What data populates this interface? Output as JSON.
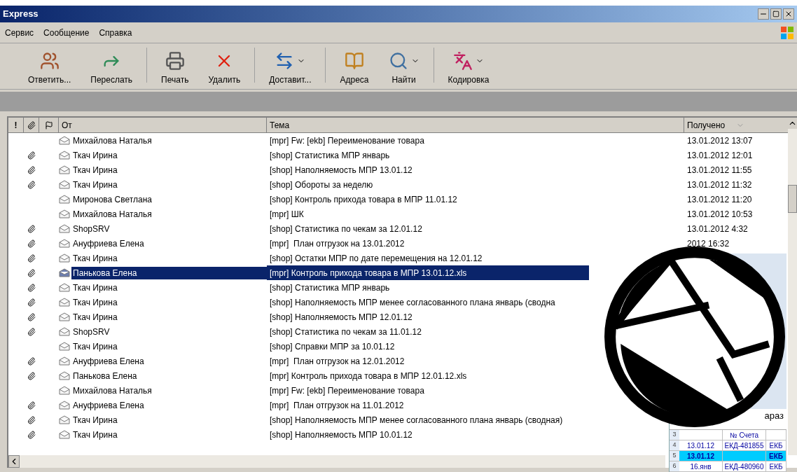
{
  "window": {
    "title": "Express"
  },
  "menu": [
    "Сервис",
    "Сообщение",
    "Справка"
  ],
  "toolbar": [
    {
      "label": "Ответить...",
      "kind": "reply",
      "dropdown": false
    },
    {
      "label": "Переслать",
      "kind": "forward",
      "dropdown": false
    },
    {
      "label": "Печать",
      "kind": "print",
      "dropdown": false
    },
    {
      "label": "Удалить",
      "kind": "delete",
      "dropdown": false
    },
    {
      "label": "Доставит...",
      "kind": "sync",
      "dropdown": true
    },
    {
      "label": "Адреса",
      "kind": "addresses",
      "dropdown": false
    },
    {
      "label": "Найти",
      "kind": "find",
      "dropdown": true
    },
    {
      "label": "Кодировка",
      "kind": "encoding",
      "dropdown": true
    }
  ],
  "table": {
    "columns": [
      "!",
      "От",
      "Тема",
      "Получено"
    ],
    "rows": [
      {
        "attachment": false,
        "selected": false,
        "from": "Михайлова Наталья",
        "subject": "[mpr] Fw: [ekb] Переименование товара",
        "received": "13.01.2012 13:07"
      },
      {
        "attachment": true,
        "selected": false,
        "from": "Ткач Ирина",
        "subject": "[shop] Статистика МПР январь",
        "received": "13.01.2012 12:01"
      },
      {
        "attachment": true,
        "selected": false,
        "from": "Ткач Ирина",
        "subject": "[shop] Наполняемость МПР 13.01.12",
        "received": "13.01.2012 11:55"
      },
      {
        "attachment": true,
        "selected": false,
        "from": "Ткач Ирина",
        "subject": "[shop] Обороты за неделю",
        "received": "13.01.2012 11:32"
      },
      {
        "attachment": false,
        "selected": false,
        "from": "Миронова Светлана",
        "subject": "[shop] Контроль прихода товара в МПР 11.01.12",
        "received": "13.01.2012 11:20"
      },
      {
        "attachment": false,
        "selected": false,
        "from": "Михайлова Наталья",
        "subject": "[mpr] ШК",
        "received": "13.01.2012 10:53"
      },
      {
        "attachment": true,
        "selected": false,
        "from": "ShopSRV",
        "subject": "[shop] Статистика по чекам за 12.01.12",
        "received": "13.01.2012 4:32"
      },
      {
        "attachment": true,
        "selected": false,
        "from": "Ануфриева Елена",
        "subject": "[mpr]  План отгрузок на 13.01.2012",
        "received": "2012 16:32"
      },
      {
        "attachment": true,
        "selected": false,
        "from": "Ткач Ирина",
        "subject": "[shop] Остатки МПР по дате перемещения на 12.01.12"
      },
      {
        "attachment": true,
        "selected": true,
        "from": "Панькова Елена",
        "subject": "[mpr] Контроль прихода товара в МПР 13.01.12.xls"
      },
      {
        "attachment": true,
        "selected": false,
        "from": "Ткач Ирина",
        "subject": "[shop] Статистика МПР январь"
      },
      {
        "attachment": true,
        "selected": false,
        "from": "Ткач Ирина",
        "subject": "[shop] Наполняемость МПР менее согласованного плана январь (сводна"
      },
      {
        "attachment": true,
        "selected": false,
        "from": "Ткач Ирина",
        "subject": "[shop] Наполняемость МПР 12.01.12"
      },
      {
        "attachment": true,
        "selected": false,
        "from": "ShopSRV",
        "subject": "[shop] Статистика по чекам за 11.01.12"
      },
      {
        "attachment": false,
        "selected": false,
        "from": "Ткач Ирина",
        "subject": "[shop] Справки МПР за 10.01.12"
      },
      {
        "attachment": true,
        "selected": false,
        "from": "Ануфриева Елена",
        "subject": "[mpr]  План отгрузок на 12.01.2012"
      },
      {
        "attachment": true,
        "selected": false,
        "from": "Панькова Елена",
        "subject": "[mpr] Контроль прихода товара в МПР 12.01.12.xls"
      },
      {
        "attachment": false,
        "selected": false,
        "from": "Михайлова Наталья",
        "subject": "[mpr] Fw: [ekb] Переименование товара"
      },
      {
        "attachment": true,
        "selected": false,
        "from": "Ануфриева Елена",
        "subject": "[mpr]  План отгрузок на 11.01.2012"
      },
      {
        "attachment": true,
        "selected": false,
        "from": "Ткач Ирина",
        "subject": "[shop] Наполняемость МПР менее согласованного плана январь (сводная)"
      },
      {
        "attachment": true,
        "selected": false,
        "from": "Ткач Ирина",
        "subject": "[shop] Наполняемость МПР 10.01.12"
      }
    ]
  },
  "spreadsheet": {
    "header_fragment": "араз",
    "rows": [
      {
        "number": "3",
        "cells": [
          "",
          "№ Счета",
          ""
        ],
        "selected": false
      },
      {
        "number": "4",
        "cells": [
          "13.01.12",
          "ЕКД-481855",
          "ЕКБ"
        ],
        "selected": false
      },
      {
        "number": "5",
        "cells": [
          "13.01.12",
          "",
          "ЕКБ"
        ],
        "selected": true
      },
      {
        "number": "6",
        "cells": [
          "16.янв",
          "ЕКД-480960",
          "ЕКБ"
        ],
        "selected": false
      }
    ]
  }
}
